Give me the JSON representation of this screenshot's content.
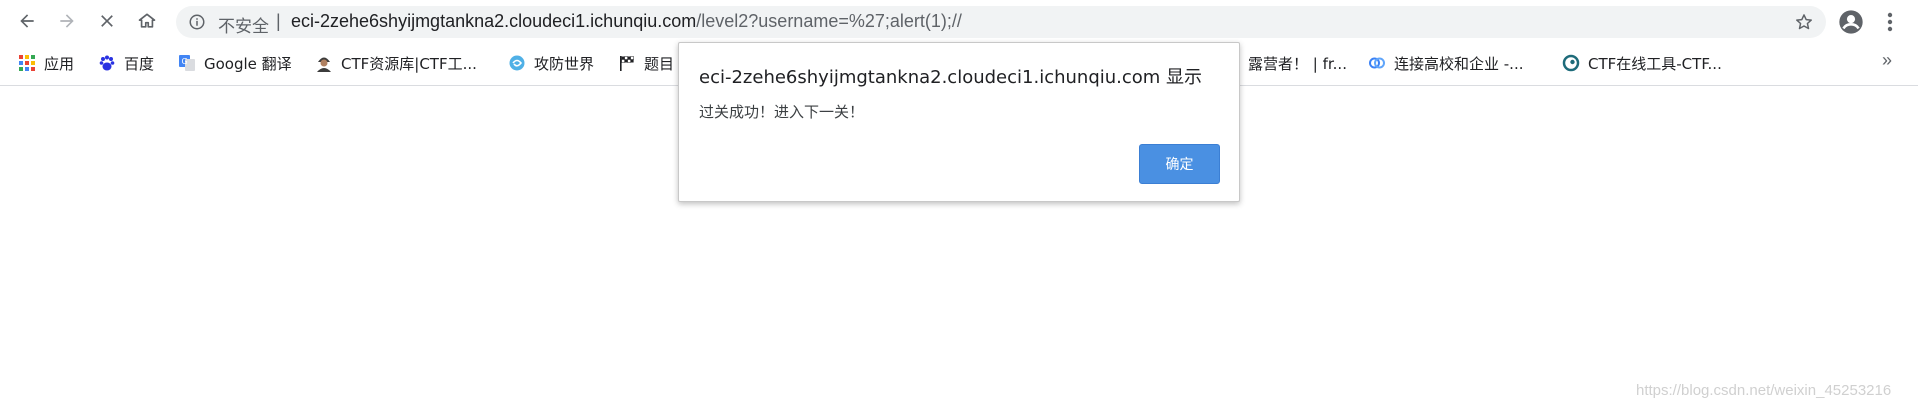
{
  "toolbar": {
    "insecure_label": "不安全",
    "separator": "|",
    "url_host": "eci-2zehe6shyijmgtankna2.cloudeci1.ichunqiu.com",
    "url_path": "/level2?username=%27;alert(1);//"
  },
  "bookmarks": {
    "items": [
      {
        "label": "应用",
        "icon": "apps-grid-icon"
      },
      {
        "label": "百度",
        "icon": "baidu-paw-icon"
      },
      {
        "label": "Google 翻译",
        "icon": "google-translate-icon"
      },
      {
        "label": "CTF资源库|CTF工...",
        "icon": "hacker-avatar-icon"
      },
      {
        "label": "攻防世界",
        "icon": "swirl-icon"
      },
      {
        "label": "题目",
        "icon": "flag-icon"
      },
      {
        "label": "露营者！ | fr...",
        "icon": "none"
      },
      {
        "label": "连接高校和企业 -...",
        "icon": "cloud-icon"
      },
      {
        "label": "CTF在线工具-CTF...",
        "icon": "ring-icon"
      }
    ],
    "more": "»"
  },
  "dialog": {
    "title": "eci-2zehe6shyijmgtankna2.cloudeci1.ichunqiu.com 显示",
    "message": "过关成功！进入下一关！",
    "ok_label": "确定"
  },
  "watermark": "https://blog.csdn.net/weixin_45253216",
  "colors": {
    "accent": "#4a90e2",
    "omnibox_bg": "#f1f3f4",
    "text_muted": "#5f6368"
  }
}
